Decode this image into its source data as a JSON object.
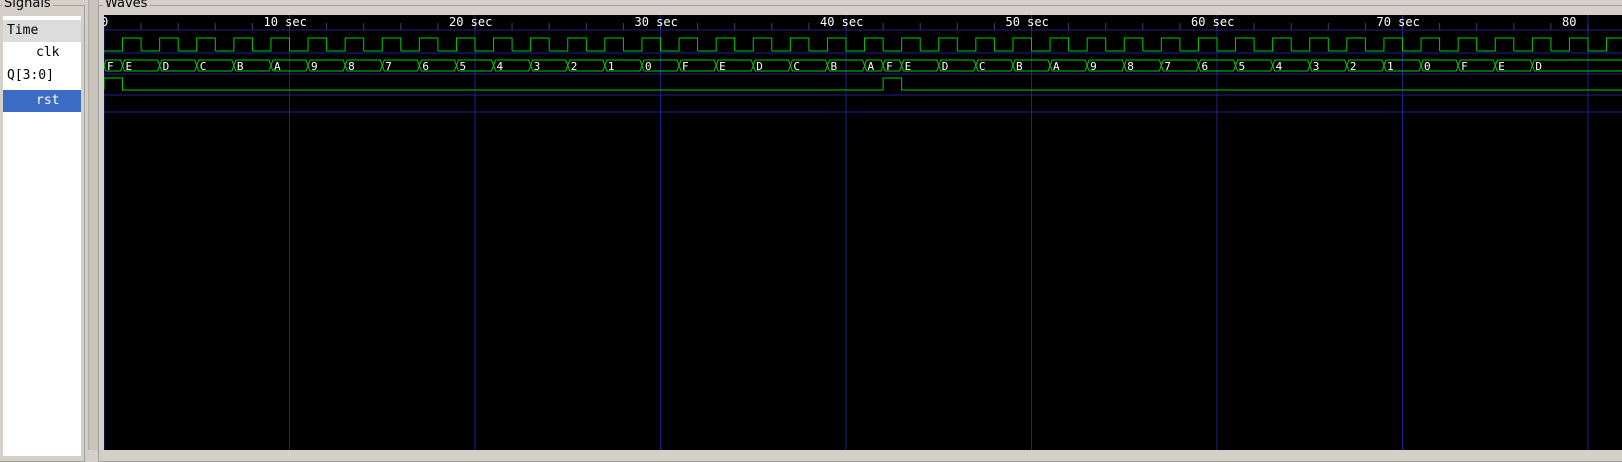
{
  "signals_panel": {
    "title": "Signals"
  },
  "waves_panel": {
    "title": "Waves"
  },
  "signals": [
    {
      "label": "Time",
      "selected": false
    },
    {
      "label": "clk",
      "selected": false
    },
    {
      "label": "Q[3:0]",
      "selected": false
    },
    {
      "label": "rst",
      "selected": true
    }
  ],
  "colors": {
    "waveform": "#00cc00",
    "background": "#000000",
    "grid": "#1f1f8f",
    "selection": "#3b6bc2"
  },
  "timeline": {
    "unit": "sec",
    "ticks": [
      "0",
      "10 sec",
      "20 sec",
      "30 sec",
      "40 sec",
      "50 sec",
      "60 sec",
      "70 sec",
      "80"
    ]
  },
  "clk": {
    "period_sec": 2
  },
  "q_bus": {
    "values": [
      {
        "t": 0,
        "v": "F"
      },
      {
        "t": 1,
        "v": "E"
      },
      {
        "t": 3,
        "v": "D"
      },
      {
        "t": 5,
        "v": "C"
      },
      {
        "t": 7,
        "v": "B"
      },
      {
        "t": 9,
        "v": "A"
      },
      {
        "t": 11,
        "v": "9"
      },
      {
        "t": 13,
        "v": "8"
      },
      {
        "t": 15,
        "v": "7"
      },
      {
        "t": 17,
        "v": "6"
      },
      {
        "t": 19,
        "v": "5"
      },
      {
        "t": 21,
        "v": "4"
      },
      {
        "t": 23,
        "v": "3"
      },
      {
        "t": 25,
        "v": "2"
      },
      {
        "t": 27,
        "v": "1"
      },
      {
        "t": 29,
        "v": "0"
      },
      {
        "t": 31,
        "v": "F"
      },
      {
        "t": 33,
        "v": "E"
      },
      {
        "t": 35,
        "v": "D"
      },
      {
        "t": 37,
        "v": "C"
      },
      {
        "t": 39,
        "v": "B"
      },
      {
        "t": 41,
        "v": "A"
      },
      {
        "t": 42,
        "v": "F"
      },
      {
        "t": 43,
        "v": "E"
      },
      {
        "t": 45,
        "v": "D"
      },
      {
        "t": 47,
        "v": "C"
      },
      {
        "t": 49,
        "v": "B"
      },
      {
        "t": 51,
        "v": "A"
      },
      {
        "t": 53,
        "v": "9"
      },
      {
        "t": 55,
        "v": "8"
      },
      {
        "t": 57,
        "v": "7"
      },
      {
        "t": 59,
        "v": "6"
      },
      {
        "t": 61,
        "v": "5"
      },
      {
        "t": 63,
        "v": "4"
      },
      {
        "t": 65,
        "v": "3"
      },
      {
        "t": 67,
        "v": "2"
      },
      {
        "t": 69,
        "v": "1"
      },
      {
        "t": 71,
        "v": "0"
      },
      {
        "t": 73,
        "v": "F"
      },
      {
        "t": 75,
        "v": "E"
      },
      {
        "t": 77,
        "v": "D"
      }
    ]
  },
  "rst": {
    "high_intervals": [
      [
        0,
        1
      ],
      [
        42,
        43
      ]
    ]
  }
}
